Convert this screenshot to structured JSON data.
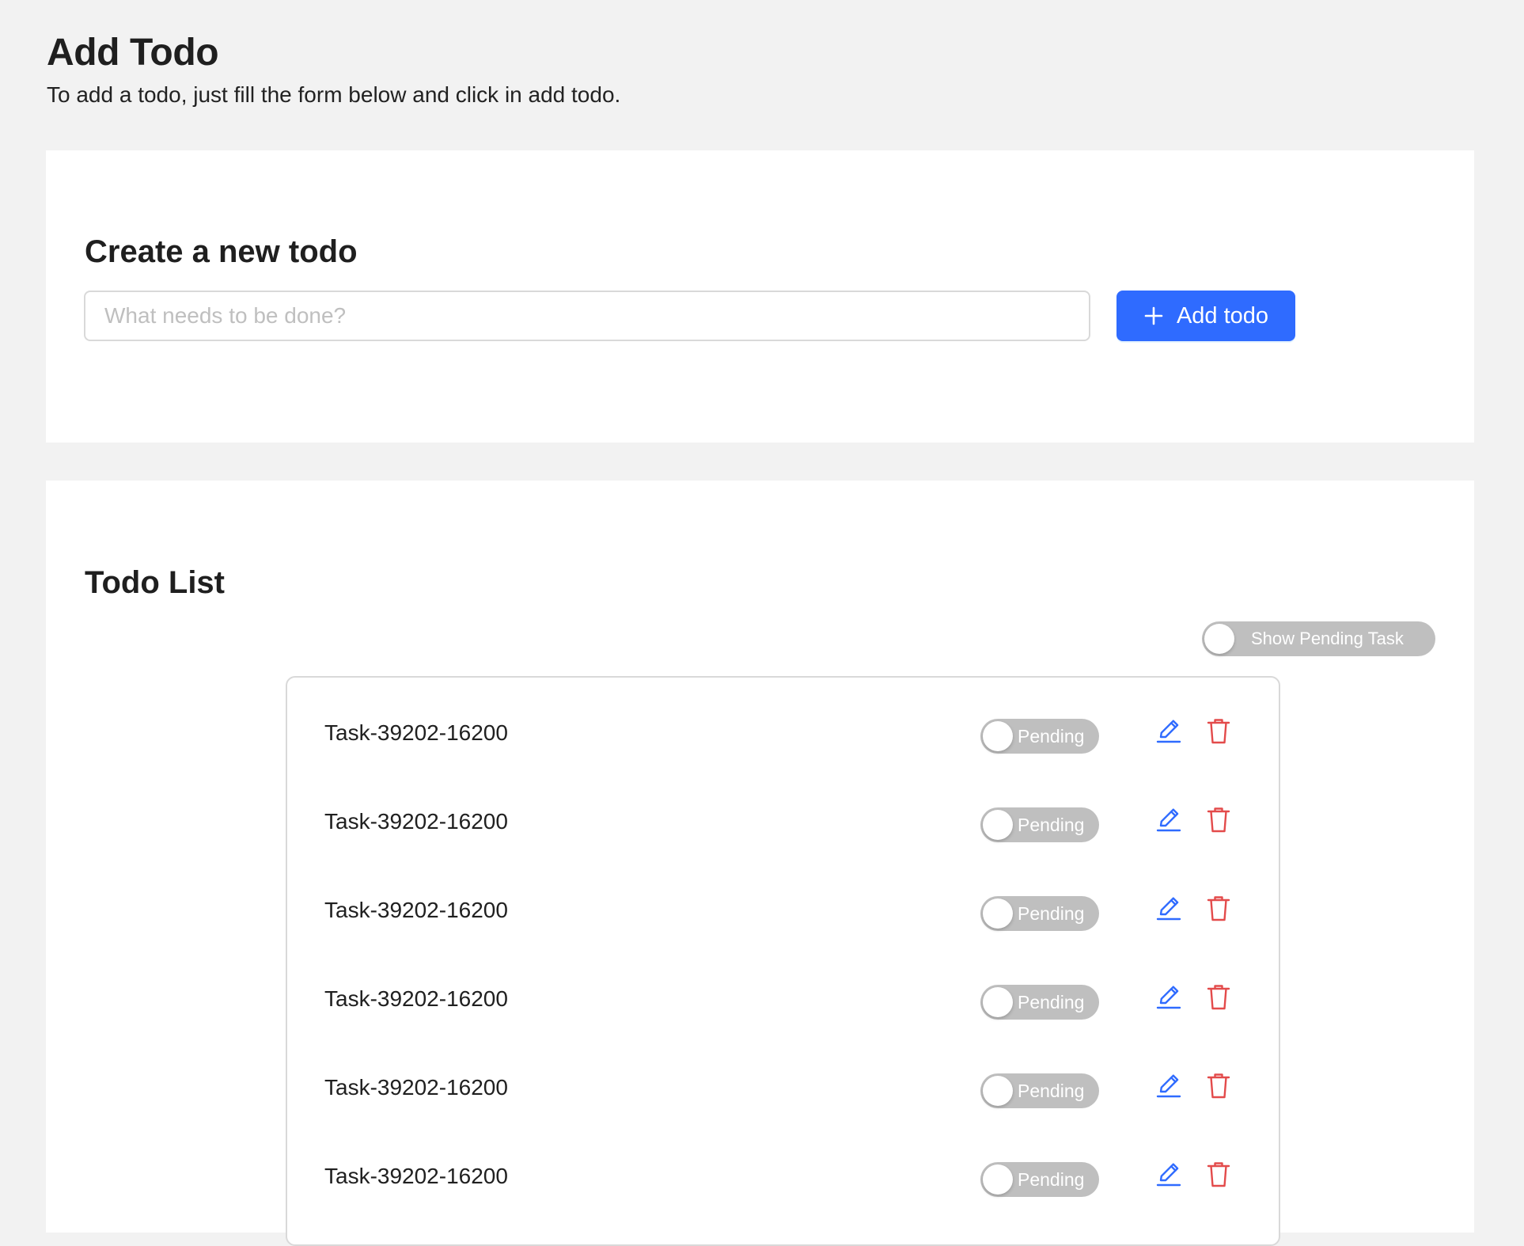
{
  "page": {
    "title": "Add Todo",
    "subtitle": "To add a todo, just fill the form below and click in add todo."
  },
  "create_form": {
    "title": "Create a new todo",
    "input_placeholder": "What needs to be done?",
    "input_value": "",
    "add_button_label": "Add todo",
    "add_icon": "plus-icon"
  },
  "todo_list": {
    "title": "Todo List",
    "filter_toggle_label": "Show Pending Task",
    "filter_toggle_state": "off",
    "items": [
      {
        "text": "Task-39202-16200",
        "status": "Pending",
        "edit_icon": "edit-icon",
        "delete_icon": "trash-icon"
      },
      {
        "text": "Task-39202-16200",
        "status": "Pending",
        "edit_icon": "edit-icon",
        "delete_icon": "trash-icon"
      },
      {
        "text": "Task-39202-16200",
        "status": "Pending",
        "edit_icon": "edit-icon",
        "delete_icon": "trash-icon"
      },
      {
        "text": "Task-39202-16200",
        "status": "Pending",
        "edit_icon": "edit-icon",
        "delete_icon": "trash-icon"
      },
      {
        "text": "Task-39202-16200",
        "status": "Pending",
        "edit_icon": "edit-icon",
        "delete_icon": "trash-icon"
      },
      {
        "text": "Task-39202-16200",
        "status": "Pending",
        "edit_icon": "edit-icon",
        "delete_icon": "trash-icon"
      }
    ]
  },
  "colors": {
    "background": "#f2f2f2",
    "card": "#ffffff",
    "primary": "#2f6bff",
    "edit": "#2f6bff",
    "delete": "#e34b4b",
    "toggle_off": "#bfbfbf",
    "input_border": "#d9d9d9"
  }
}
